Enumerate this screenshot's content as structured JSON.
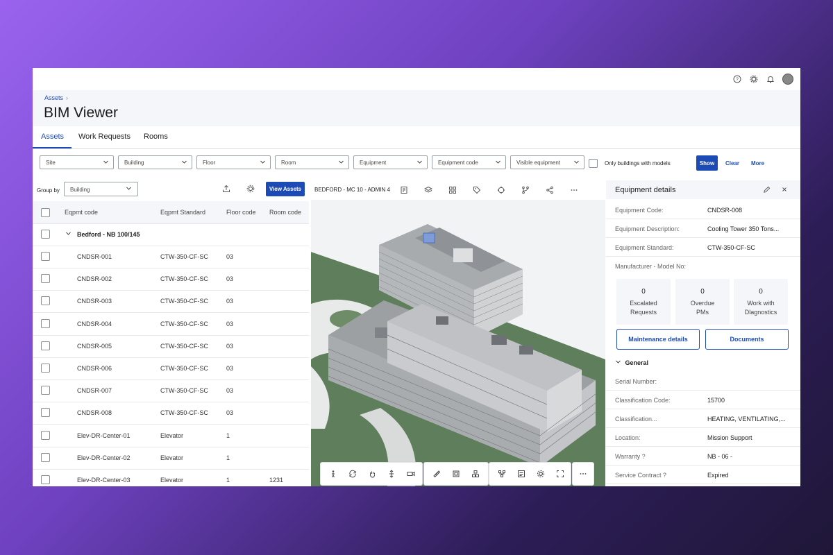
{
  "topbar": {
    "icons": [
      "help-icon",
      "settings-icon",
      "bell-icon",
      "avatar"
    ]
  },
  "breadcrumb": {
    "items": [
      "Assets"
    ]
  },
  "page": {
    "title": "BIM Viewer"
  },
  "tabs": [
    {
      "label": "Assets",
      "active": true
    },
    {
      "label": "Work Requests",
      "active": false
    },
    {
      "label": "Rooms",
      "active": false
    }
  ],
  "filters": {
    "selects": [
      "Site",
      "Building",
      "Floor",
      "Room",
      "Equipment",
      "Equipment code",
      "Visible equipment"
    ],
    "only_buildings_label": "Only buildings with models",
    "show_label": "Show",
    "clear_label": "Clear",
    "more_label": "More"
  },
  "left_panel": {
    "group_by_label": "Group by",
    "group_by_value": "Building",
    "view_assets_label": "View Assets",
    "columns": [
      "Eqpmt code",
      "Eqpmt Standard",
      "Floor code",
      "Room code"
    ],
    "group_name": "Bedford - NB 100/145",
    "rows": [
      {
        "code": "CNDSR-001",
        "standard": "CTW-350-CF-SC",
        "floor": "03",
        "room": ""
      },
      {
        "code": "CNDSR-002",
        "standard": "CTW-350-CF-SC",
        "floor": "03",
        "room": ""
      },
      {
        "code": "CNDSR-003",
        "standard": "CTW-350-CF-SC",
        "floor": "03",
        "room": ""
      },
      {
        "code": "CNDSR-004",
        "standard": "CTW-350-CF-SC",
        "floor": "03",
        "room": ""
      },
      {
        "code": "CNDSR-005",
        "standard": "CTW-350-CF-SC",
        "floor": "03",
        "room": ""
      },
      {
        "code": "CNDSR-006",
        "standard": "CTW-350-CF-SC",
        "floor": "03",
        "room": ""
      },
      {
        "code": "CNDSR-007",
        "standard": "CTW-350-CF-SC",
        "floor": "03",
        "room": ""
      },
      {
        "code": "CNDSR-008",
        "standard": "CTW-350-CF-SC",
        "floor": "03",
        "room": ""
      },
      {
        "code": "Elev-DR-Center-01",
        "standard": "Elevator",
        "floor": "1",
        "room": ""
      },
      {
        "code": "Elev-DR-Center-02",
        "standard": "Elevator",
        "floor": "1",
        "room": ""
      },
      {
        "code": "Elev-DR-Center-03",
        "standard": "Elevator",
        "floor": "1",
        "room": "1231"
      }
    ]
  },
  "viewer": {
    "title": "BEDFORD - MC 10 - ADMIN 4",
    "toolbar_icons": [
      "floorplan-icon",
      "layers-icon",
      "grid-icon",
      "tag-icon",
      "target-icon",
      "branch-icon",
      "share-icon",
      "more-icon"
    ],
    "bottom_toolbar_icons": [
      "person-icon",
      "orbit-icon",
      "pan-icon",
      "vertical-move-icon",
      "camera-icon",
      "measure-icon",
      "section-box-icon",
      "explode-icon",
      "tree-icon",
      "properties-icon",
      "settings-icon",
      "fullscreen-icon",
      "more-icon"
    ]
  },
  "details": {
    "title": "Equipment details",
    "props_top": [
      {
        "k": "Equipment Code:",
        "v": "CNDSR-008"
      },
      {
        "k": "Equipment Description:",
        "v": "Cooling Tower 350 Tons..."
      },
      {
        "k": "Equipment Standard:",
        "v": "CTW-350-CF-SC"
      },
      {
        "k": "Manufacturer - Model No:",
        "v": ""
      }
    ],
    "stats": [
      {
        "n": "0",
        "l1": "Escalated",
        "l2": "Requests"
      },
      {
        "n": "0",
        "l1": "Overdue",
        "l2": "PMs"
      },
      {
        "n": "0",
        "l1": "Work with",
        "l2": "Dlagnostics"
      }
    ],
    "maintenance_label": "Maintenance details",
    "documents_label": "Documents",
    "section_title": "General",
    "props_general": [
      {
        "k": "Serial Number:",
        "v": ""
      },
      {
        "k": "Classification Code:",
        "v": "15700"
      },
      {
        "k": "Classification...",
        "v": "HEATING, VENTILATING,..."
      },
      {
        "k": "Location:",
        "v": "Mission Support"
      },
      {
        "k": "Warranty ?",
        "v": "NB - 06 -"
      },
      {
        "k": "Service Contract ?",
        "v": "Expired"
      }
    ]
  },
  "colors": {
    "accent": "#1d4bb5",
    "panel": "#f4f6f9",
    "grass": "#5f7f5c"
  }
}
